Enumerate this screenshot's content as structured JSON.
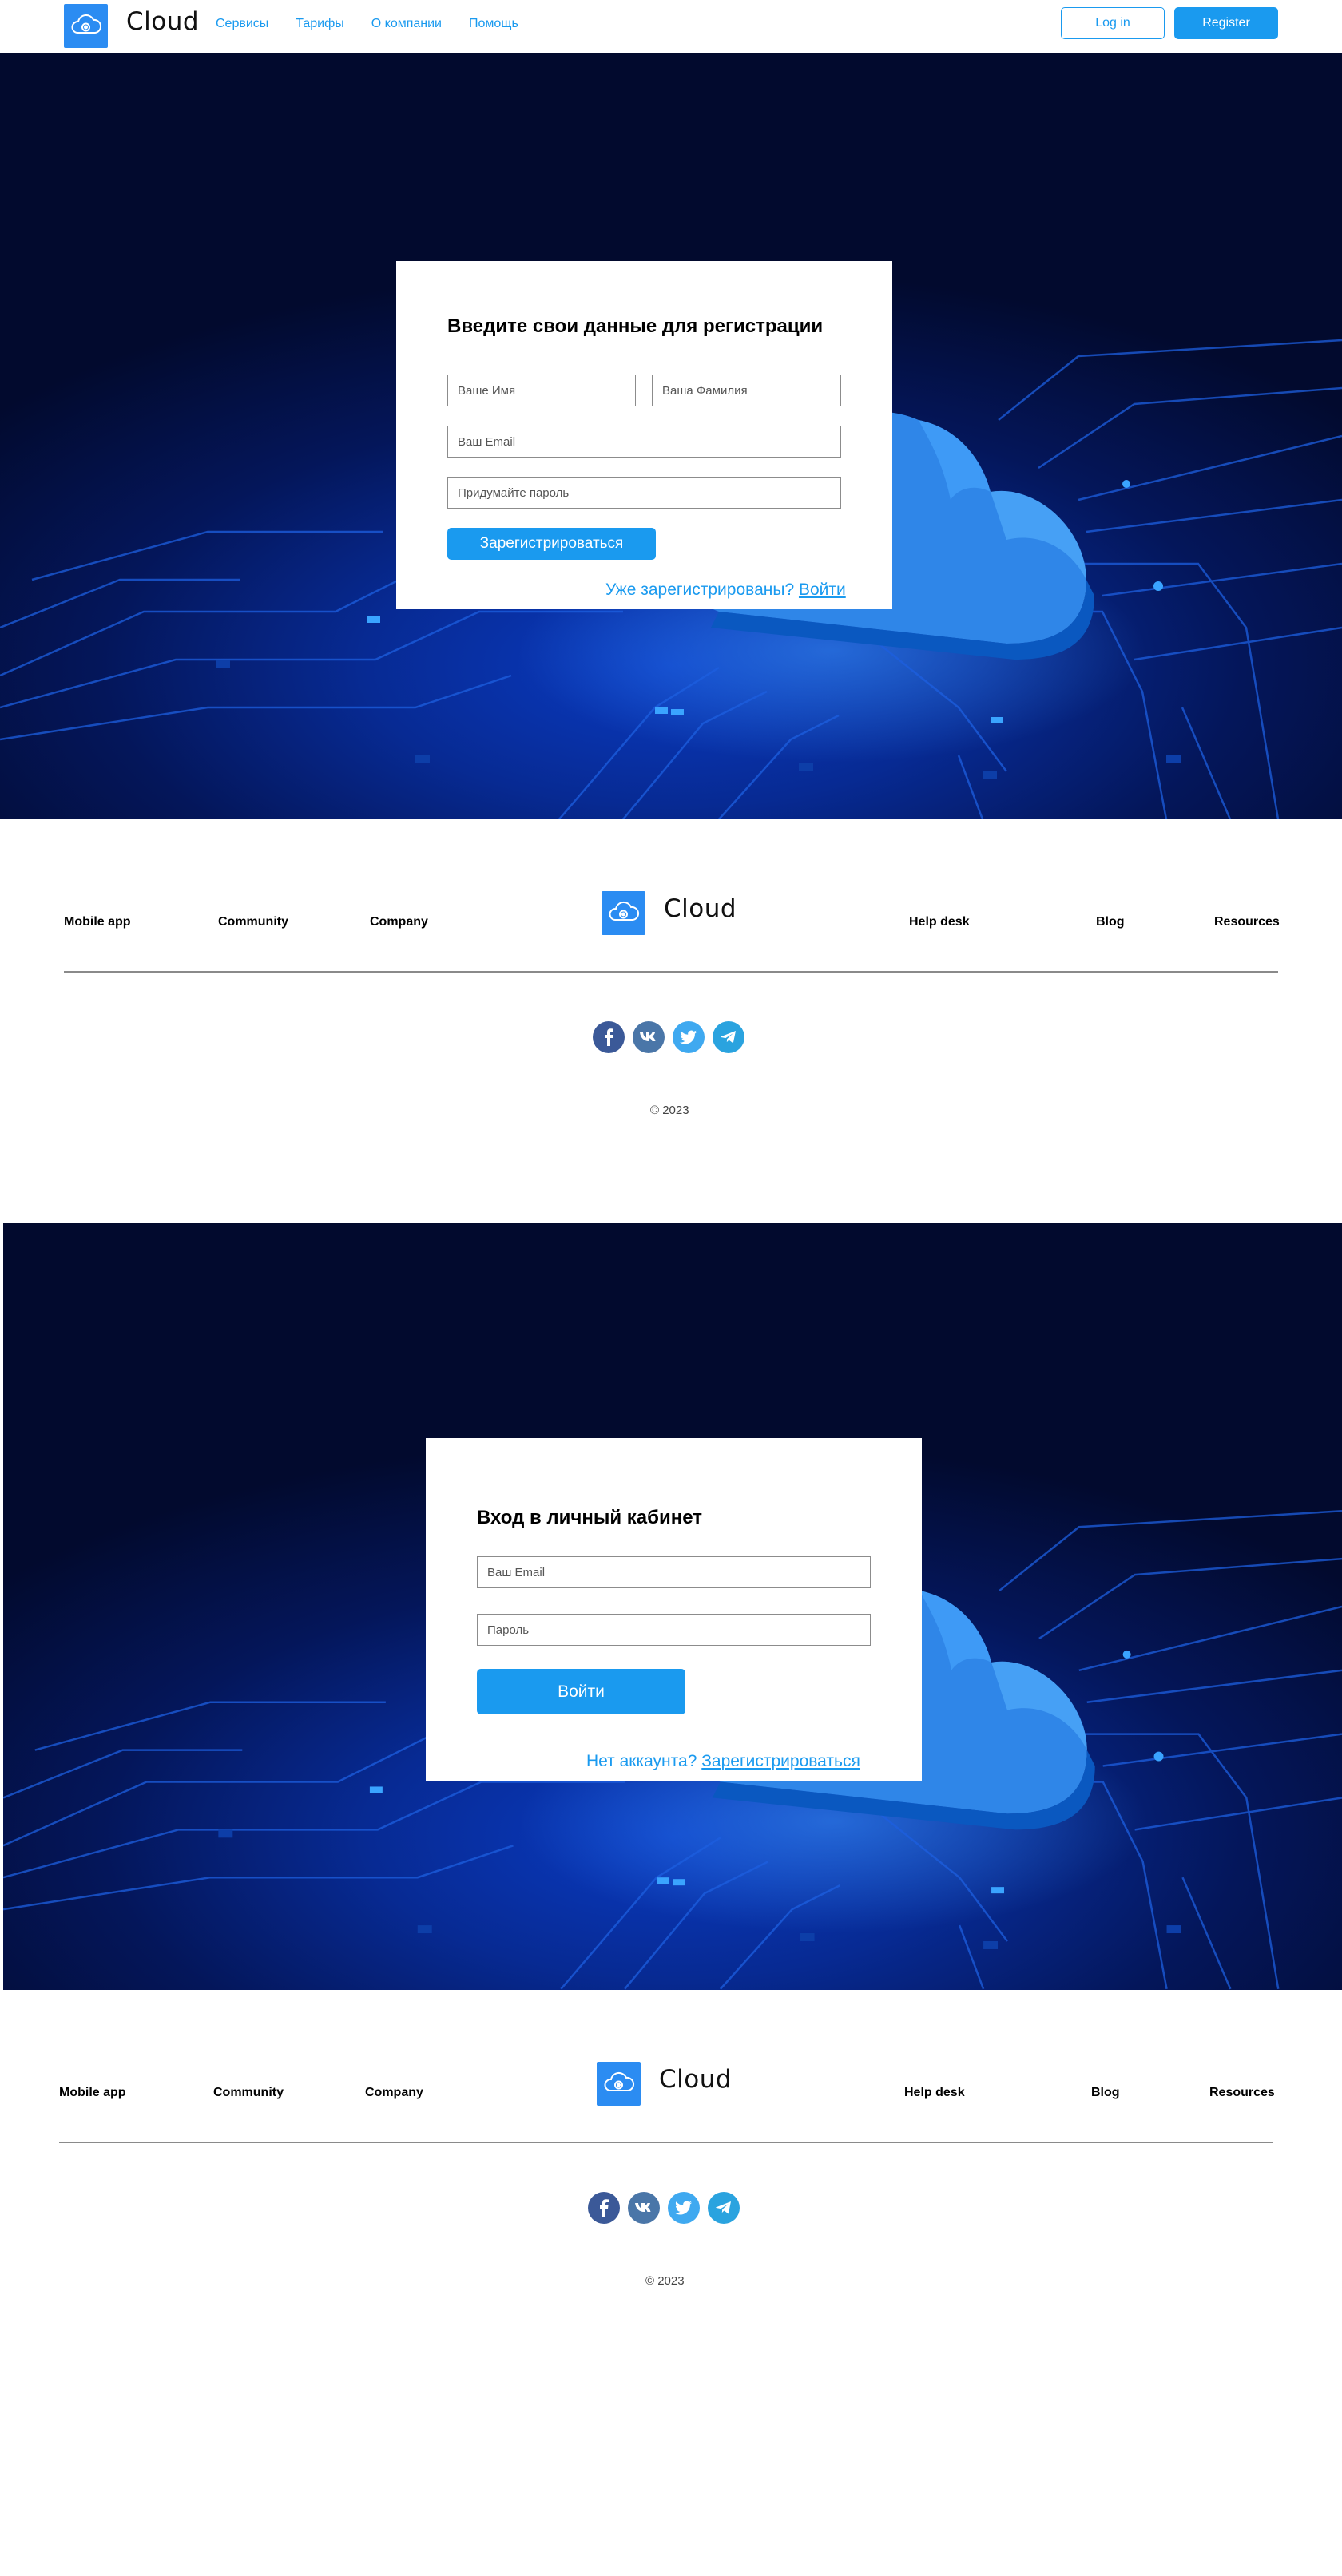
{
  "header": {
    "brand": "Cloud",
    "nav": [
      "Сервисы",
      "Тарифы",
      "О компании",
      "Помощь"
    ],
    "login_label": "Log in",
    "register_label": "Register"
  },
  "register_form": {
    "title": "Введите свои данные для регистрации",
    "first_name_placeholder": "Ваше Имя",
    "last_name_placeholder": "Ваша Фамилия",
    "email_placeholder": "Ваш Email",
    "password_placeholder": "Придумайте пароль",
    "submit_label": "Зарегистрироваться",
    "have_account_text": "Уже зарегистрированы?",
    "login_link": "Войти"
  },
  "login_form": {
    "title": "Вход в личный кабинет",
    "email_placeholder": "Ваш Email",
    "password_placeholder": "Пароль",
    "submit_label": "Войти",
    "no_account_text": "Нет аккаунта?",
    "register_link": "Зарегистрироваться"
  },
  "footer": {
    "brand": "Cloud",
    "links_left": [
      "Mobile app",
      "Community",
      "Company"
    ],
    "links_right": [
      "Help desk",
      "Blog",
      "Resources"
    ],
    "socials": [
      "facebook-icon",
      "vk-icon",
      "twitter-icon",
      "telegram-icon"
    ],
    "copyright": "© 2023"
  },
  "colors": {
    "accent": "#1a9aef",
    "logo": "#2b8cf2",
    "hero_dark": "#020a2e",
    "hero_glow": "#0a3bc2"
  }
}
